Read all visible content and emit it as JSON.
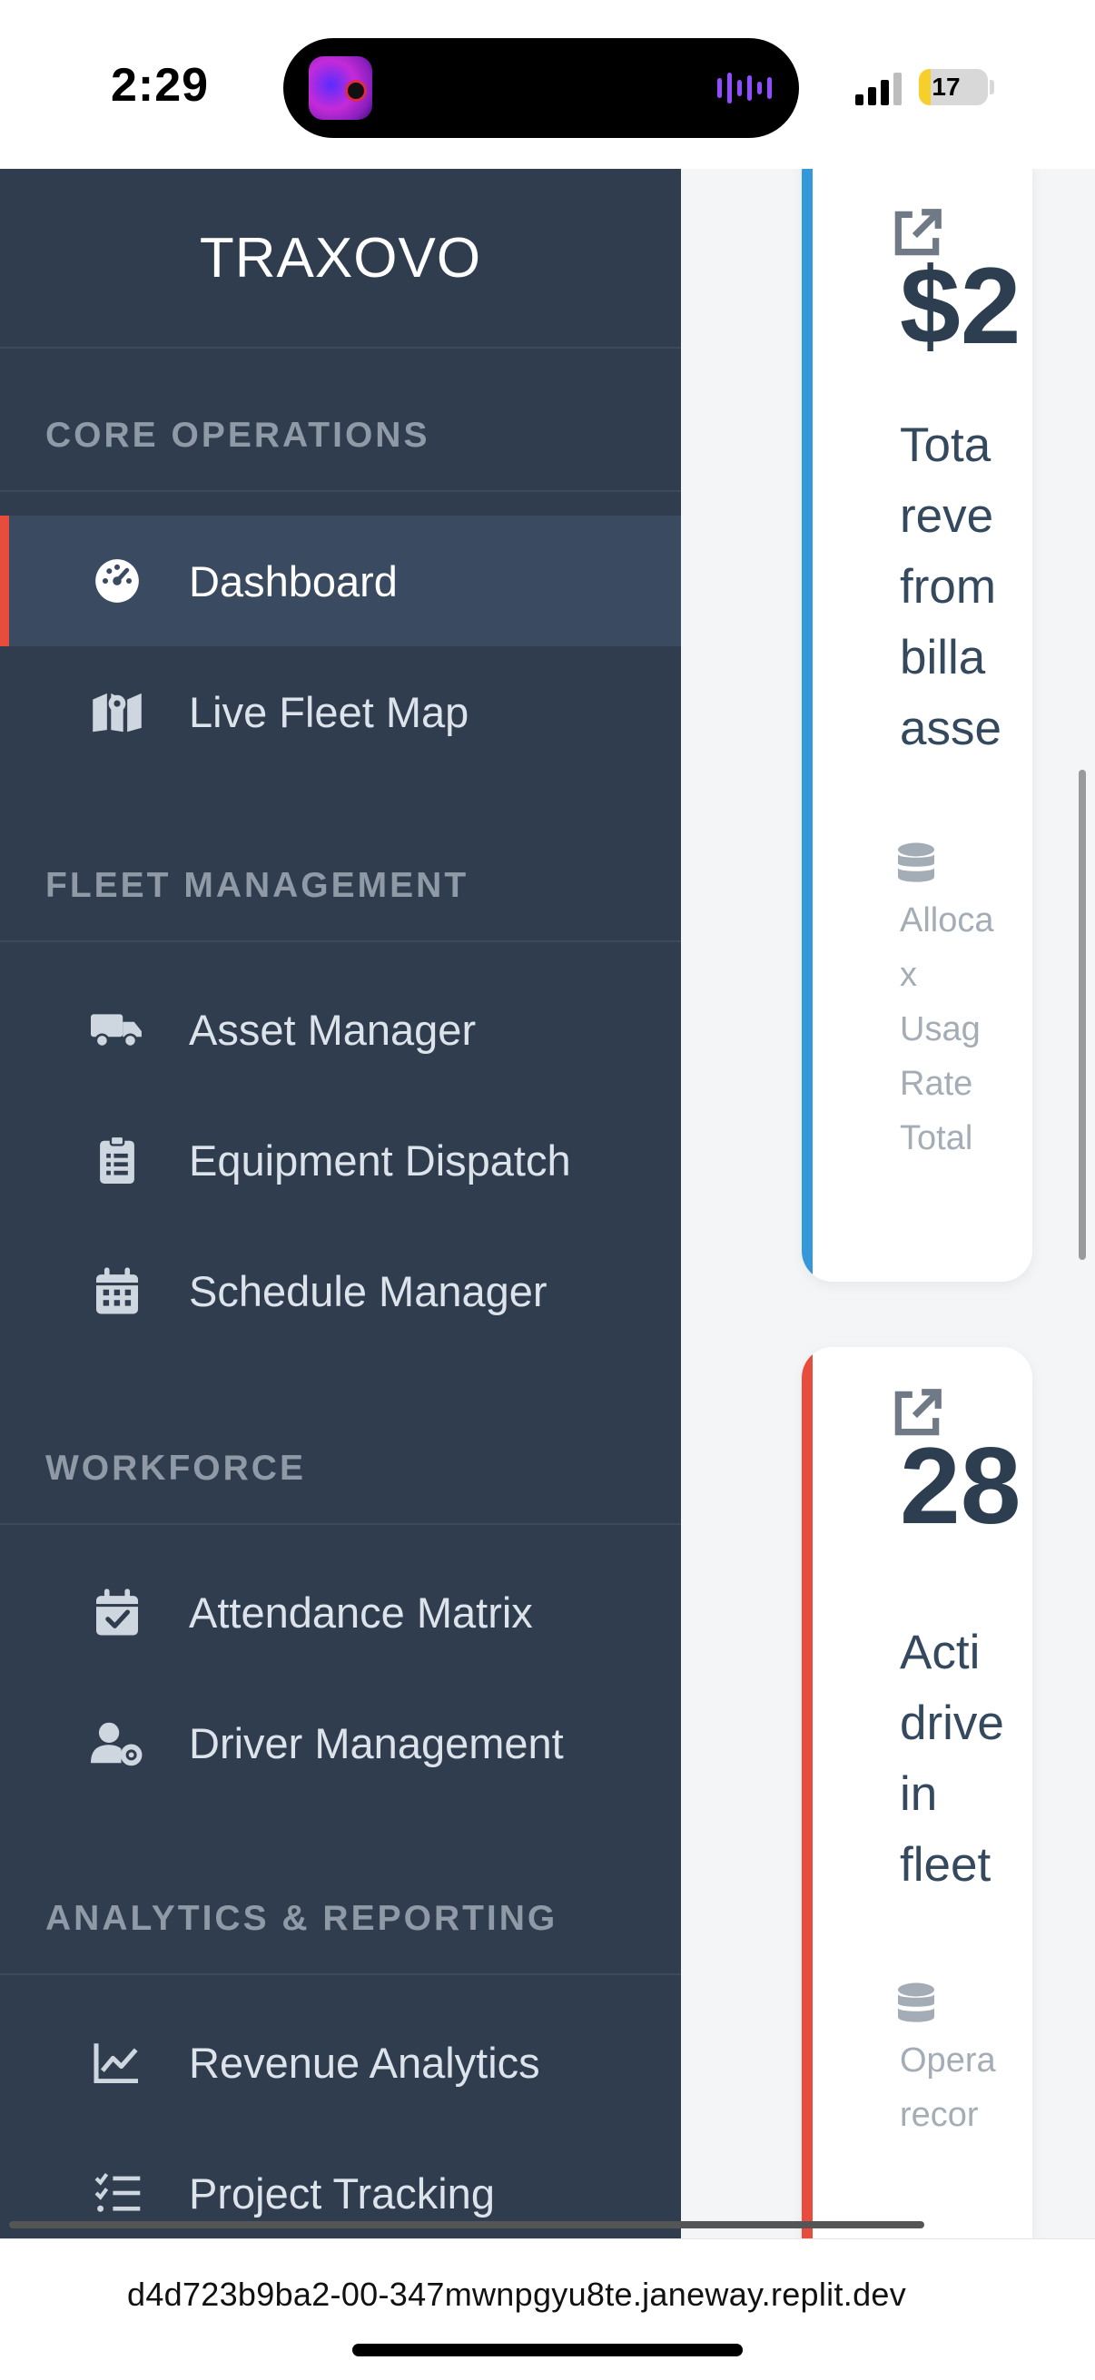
{
  "status_bar": {
    "time": "2:29",
    "battery": "17",
    "battery_level_percent": 17
  },
  "sidebar": {
    "brand": "TRAXOVO",
    "sections": [
      {
        "title": "CORE OPERATIONS",
        "items": [
          {
            "label": "Dashboard",
            "icon": "tachometer-icon",
            "active": true
          },
          {
            "label": "Live Fleet Map",
            "icon": "map-icon"
          }
        ]
      },
      {
        "title": "FLEET MANAGEMENT",
        "items": [
          {
            "label": "Asset Manager",
            "icon": "truck-icon"
          },
          {
            "label": "Equipment Dispatch",
            "icon": "clipboard-list-icon"
          },
          {
            "label": "Schedule Manager",
            "icon": "calendar-icon"
          }
        ]
      },
      {
        "title": "WORKFORCE",
        "items": [
          {
            "label": "Attendance Matrix",
            "icon": "calendar-check-icon"
          },
          {
            "label": "Driver Management",
            "icon": "user-gear-icon"
          }
        ]
      },
      {
        "title": "ANALYTICS & REPORTING",
        "items": [
          {
            "label": "Revenue Analytics",
            "icon": "line-chart-icon"
          },
          {
            "label": "Project Tracking",
            "icon": "task-list-icon"
          }
        ]
      }
    ]
  },
  "cards": [
    {
      "accent_color": "#3498db",
      "value": "$2",
      "description_lines": [
        "Tota",
        "reve",
        "from",
        "billa",
        "asse"
      ],
      "note_lines": [
        "Alloca",
        "x",
        "Usag",
        "Rate",
        "Total"
      ]
    },
    {
      "accent_color": "#e74c3c",
      "value": "28",
      "description_lines": [
        "Acti",
        "drive",
        "in",
        "fleet"
      ],
      "note_lines": [
        "Opera",
        "recor"
      ]
    }
  ],
  "url_bar": {
    "url": "d4d723b9ba2-00-347mwnpgyu8te.janeway.replit.dev"
  }
}
